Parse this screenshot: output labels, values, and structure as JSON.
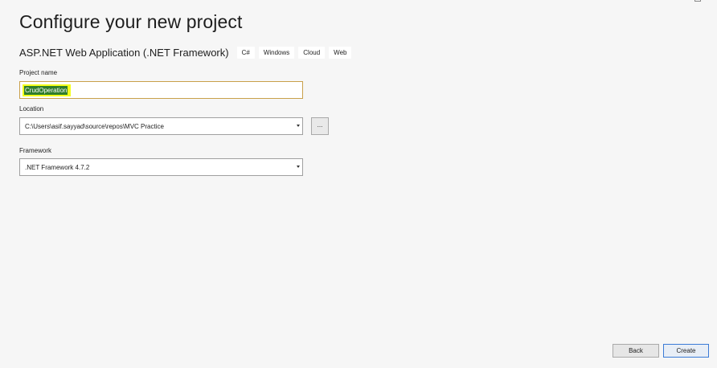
{
  "page": {
    "title": "Configure your new project"
  },
  "template": {
    "name": "ASP.NET Web Application (.NET Framework)",
    "tags": [
      "C#",
      "Windows",
      "Cloud",
      "Web"
    ]
  },
  "project_name": {
    "label": "Project name",
    "value": "CrudOperation"
  },
  "location": {
    "label": "Location",
    "value": "C:\\Users\\asif.sayyad\\source\\repos\\MVC Practice",
    "browse_label": "..."
  },
  "framework": {
    "label": "Framework",
    "value": ".NET Framework 4.7.2"
  },
  "footer": {
    "back_label": "Back",
    "create_label": "Create"
  },
  "colors": {
    "background": "#f6f6f6",
    "input_focus_border": "#c9a04a",
    "selection_highlight": "#f3ff1a",
    "selection_background": "#2f7d2a",
    "primary_button_border": "#3b7bd6"
  }
}
